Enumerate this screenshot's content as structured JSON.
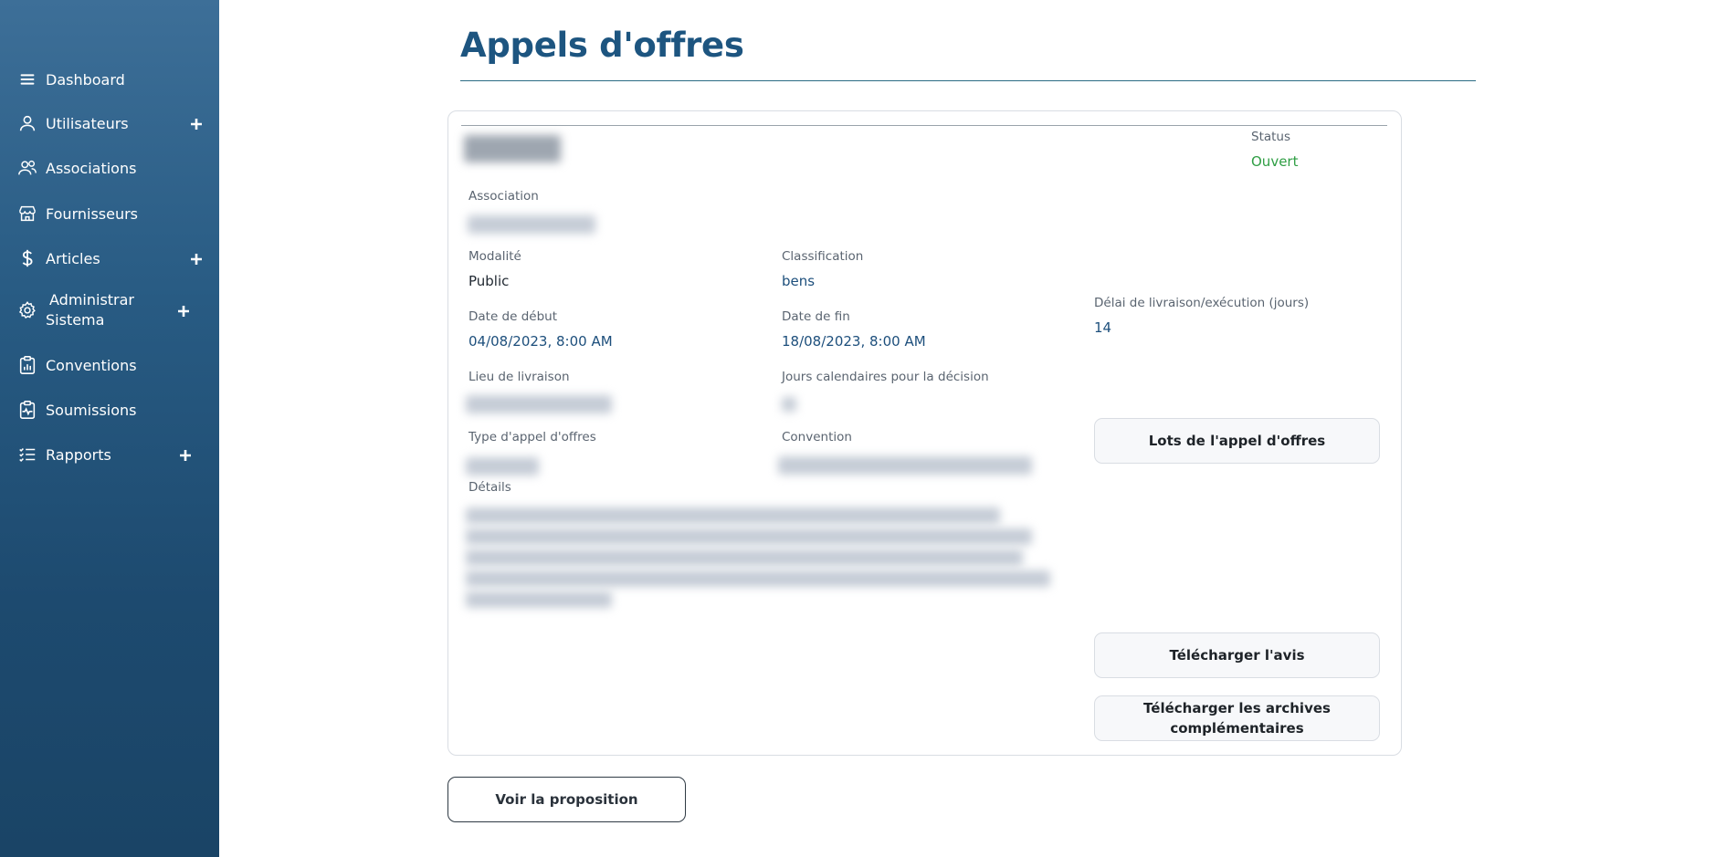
{
  "sidebar": {
    "items": [
      {
        "label": "Dashboard",
        "icon": "menu-icon"
      },
      {
        "label": "Utilisateurs",
        "icon": "user-icon",
        "expandable": true
      },
      {
        "label": "Associations",
        "icon": "users-icon"
      },
      {
        "label": "Fournisseurs",
        "icon": "store-icon"
      },
      {
        "label": "Articles",
        "icon": "dollar-icon",
        "expandable": true
      },
      {
        "label": "Administrar",
        "label2": "Sistema",
        "icon": "gear-icon",
        "expandable": true
      },
      {
        "label": "Conventions",
        "icon": "clipboard-chart-icon"
      },
      {
        "label": "Soumissions",
        "icon": "clipboard-pulse-icon"
      },
      {
        "label": "Rapports",
        "icon": "list-icon",
        "expandable": true
      }
    ]
  },
  "page": {
    "title": "Appels d'offres"
  },
  "detail": {
    "status_label": "Status",
    "status_value": "Ouvert",
    "association_label": "Association",
    "modalite_label": "Modalité",
    "modalite_value": "Public",
    "classification_label": "Classification",
    "classification_value": "bens",
    "delai_label": "Délai de livraison/exécution (jours)",
    "delai_value": "14",
    "date_debut_label": "Date de début",
    "date_debut_value": "04/08/2023, 8:00 AM",
    "date_fin_label": "Date de fin",
    "date_fin_value": "18/08/2023, 8:00 AM",
    "lieu_label": "Lieu de livraison",
    "jours_label": "Jours calendaires pour la décision",
    "type_label": "Type d'appel d'offres",
    "convention_label": "Convention",
    "details_label": "Détails"
  },
  "buttons": {
    "lots": "Lots de l'appel d'offres",
    "avis": "Télécharger l'avis",
    "archives": "Télécharger les archives complémentaires",
    "proposition": "Voir la proposition"
  },
  "colors": {
    "accent": "#1d5580",
    "status_open": "#2f9e44",
    "sidebar_top": "#3d6f98",
    "sidebar_bottom": "#1a4466"
  }
}
